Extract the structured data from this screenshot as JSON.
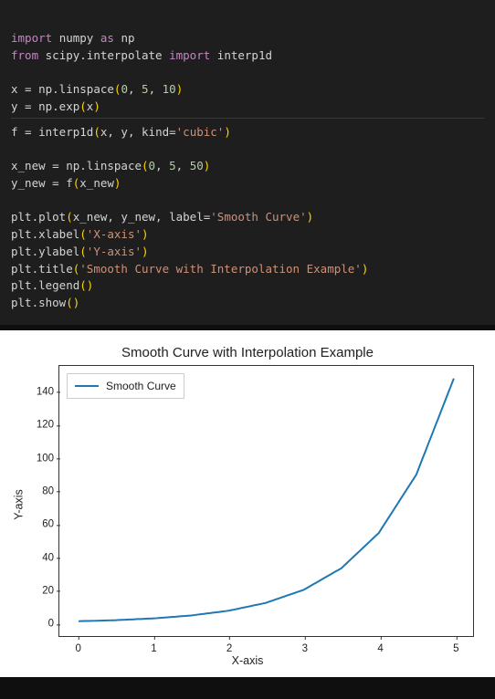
{
  "code": {
    "l1_import": "import",
    "l1_numpy": "numpy",
    "l1_as": "as",
    "l1_np": "np",
    "l2_from": "from",
    "l2_scipy": "scipy.interpolate",
    "l2_import": "import",
    "l2_interp": "interp1d",
    "l4_x": "x",
    "l4_eq": " = ",
    "l4_np": "np.linspace",
    "l4_args": "0, 5, 10",
    "l4_n0": "0",
    "l4_n1": "5",
    "l4_n2": "10",
    "l5_y": "y",
    "l5_eq": " = ",
    "l5_np": "np.exp",
    "l5_arg": "x",
    "l7_f": "f",
    "l7_eq": " = ",
    "l7_fn": "interp1d",
    "l7_xy": "x, y, kind=",
    "l7_kind": "'cubic'",
    "l9_xn": "x_new",
    "l9_eq": " = ",
    "l9_np": "np.linspace",
    "l9_n0": "0",
    "l9_n1": "5",
    "l9_n2": "50",
    "l10_yn": "y_new",
    "l10_eq": " = ",
    "l10_f": "f",
    "l10_arg": "x_new",
    "l12": "plt.plot",
    "l12_args1": "x_new, y_new, label=",
    "l12_str": "'Smooth Curve'",
    "l13": "plt.xlabel",
    "l13_str": "'X-axis'",
    "l14": "plt.ylabel",
    "l14_str": "'Y-axis'",
    "l15": "plt.title",
    "l15_str": "'Smooth Curve with Interpolation Example'",
    "l16": "plt.legend",
    "l17": "plt.show"
  },
  "chart_data": {
    "type": "line",
    "title": "Smooth Curve with Interpolation Example",
    "xlabel": "X-axis",
    "ylabel": "Y-axis",
    "x_ticks": [
      0,
      1,
      2,
      3,
      4,
      5
    ],
    "y_ticks": [
      0,
      20,
      40,
      60,
      80,
      100,
      120,
      140
    ],
    "xlim": [
      -0.25,
      5.25
    ],
    "ylim": [
      -8,
      156
    ],
    "legend": {
      "position": "upper left",
      "entries": [
        "Smooth Curve"
      ]
    },
    "series": [
      {
        "name": "Smooth Curve",
        "color": "#1f77b4",
        "x": [
          0,
          0.5,
          1,
          1.5,
          2,
          2.5,
          3,
          3.5,
          4,
          4.5,
          5
        ],
        "y": [
          1.0,
          1.65,
          2.72,
          4.48,
          7.39,
          12.18,
          20.09,
          33.12,
          54.6,
          90.02,
          148.41
        ]
      }
    ]
  }
}
